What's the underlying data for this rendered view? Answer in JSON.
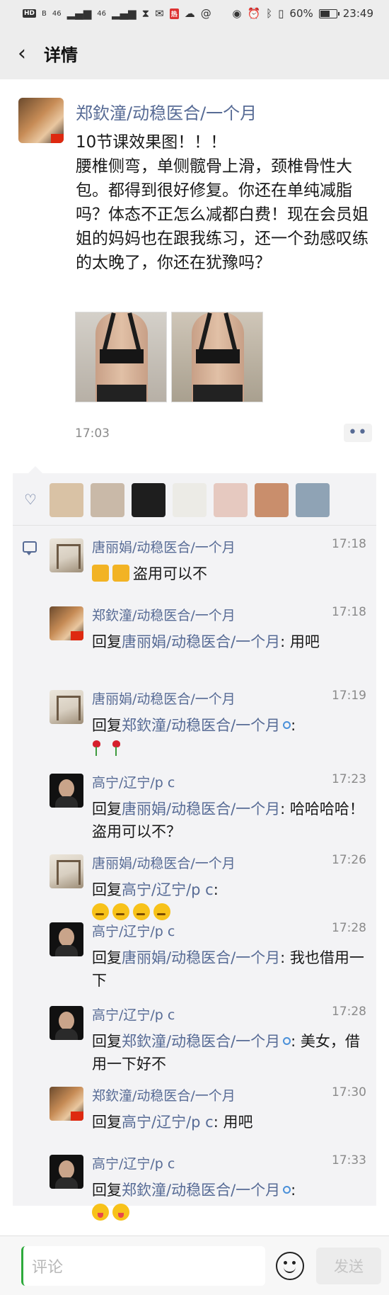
{
  "status_bar": {
    "chips": [
      "HD",
      "B",
      "46",
      "46"
    ],
    "alert_chip": "热",
    "battery": "60%",
    "time": "23:49",
    "battery_level": 0.6
  },
  "nav": {
    "back_icon": "chevron-left-icon",
    "title": "详情"
  },
  "post": {
    "author": "郑欽潼/动稳医合/一个月",
    "text": "10节课效果图！！！\n腰椎侧弯，单侧髋骨上滑，颈椎骨性大包。都得到很好修复。你还在单纯减脂吗？体态不正怎么减都白费！现在会员姐姐的妈妈也在跟我练习，还一个劲感叹练的太晚了，你还在犹豫吗？",
    "photos": [
      "back-photo-before",
      "back-photo-after"
    ],
    "time": "17:03",
    "more_label": "••"
  },
  "likes": {
    "icon": "heart-icon",
    "avatars": [
      "liker-1",
      "liker-2",
      "liker-3",
      "liker-4",
      "liker-5",
      "liker-6",
      "liker-7"
    ],
    "avatar_colors": [
      "#d9c2a5",
      "#c9b9a8",
      "#1e1e1e",
      "#ecebe6",
      "#e6c9c0",
      "#c98e6c",
      "#8fa3b5"
    ]
  },
  "comments": [
    {
      "name": "唐丽娟/动稳医合/一个月",
      "time": "17:18",
      "avatar": "tang",
      "prefix": "",
      "target": "",
      "ring": false,
      "text": "盗用可以不",
      "emoji_before": [
        "thumbs-up-emoji",
        "thumbs-up-emoji"
      ],
      "emoji_after": []
    },
    {
      "name": "郑欽潼/动稳医合/一个月",
      "time": "17:18",
      "avatar": "zheng",
      "prefix": "回复",
      "target": "唐丽娟/动稳医合/一个月",
      "ring": false,
      "text": ": 用吧",
      "emoji_before": [],
      "emoji_after": []
    },
    {
      "name": "唐丽娟/动稳医合/一个月",
      "time": "17:19",
      "avatar": "tang",
      "prefix": "回复",
      "target": "郑欽潼/动稳医合/一个月",
      "ring": true,
      "text": ":",
      "emoji_before": [],
      "emoji_after": [
        "rose-emoji",
        "rose-emoji"
      ]
    },
    {
      "name": "高宁/辽宁/p c",
      "time": "17:23",
      "avatar": "gao",
      "prefix": "回复",
      "target": "唐丽娟/动稳医合/一个月",
      "ring": false,
      "text": ": 哈哈哈哈！盗用可以不？",
      "emoji_before": [],
      "emoji_after": []
    },
    {
      "name": "唐丽娟/动稳医合/一个月",
      "time": "17:26",
      "avatar": "tang",
      "prefix": "回复",
      "target": "高宁/辽宁/p c",
      "ring": false,
      "text": ": ",
      "emoji_before": [],
      "emoji_after": [
        "thinking-emoji",
        "thinking-emoji",
        "thinking-emoji",
        "thinking-emoji"
      ]
    },
    {
      "name": "高宁/辽宁/p c",
      "time": "17:28",
      "avatar": "gao",
      "prefix": "回复",
      "target": "唐丽娟/动稳医合/一个月",
      "ring": false,
      "text": ": 我也借用一下",
      "emoji_before": [],
      "emoji_after": []
    },
    {
      "name": "高宁/辽宁/p c",
      "time": "17:28",
      "avatar": "gao",
      "prefix": "回复",
      "target": "郑欽潼/动稳医合/一个月",
      "ring": true,
      "text": ": 美女，借用一下好不",
      "emoji_before": [],
      "emoji_after": []
    },
    {
      "name": "郑欽潼/动稳医合/一个月",
      "time": "17:30",
      "avatar": "zheng",
      "prefix": "回复",
      "target": "高宁/辽宁/p c",
      "ring": false,
      "text": ": 用吧",
      "emoji_before": [],
      "emoji_after": []
    },
    {
      "name": "高宁/辽宁/p c",
      "time": "17:33",
      "avatar": "gao",
      "prefix": "回复",
      "target": "郑欽潼/动稳医合/一个月",
      "ring": true,
      "text": ":",
      "emoji_before": [],
      "emoji_after": [
        "tongue-emoji",
        "tongue-emoji"
      ]
    }
  ],
  "bottom_bar": {
    "placeholder": "评论",
    "emoji_icon": "smiley-face-icon",
    "send_label": "发送"
  }
}
